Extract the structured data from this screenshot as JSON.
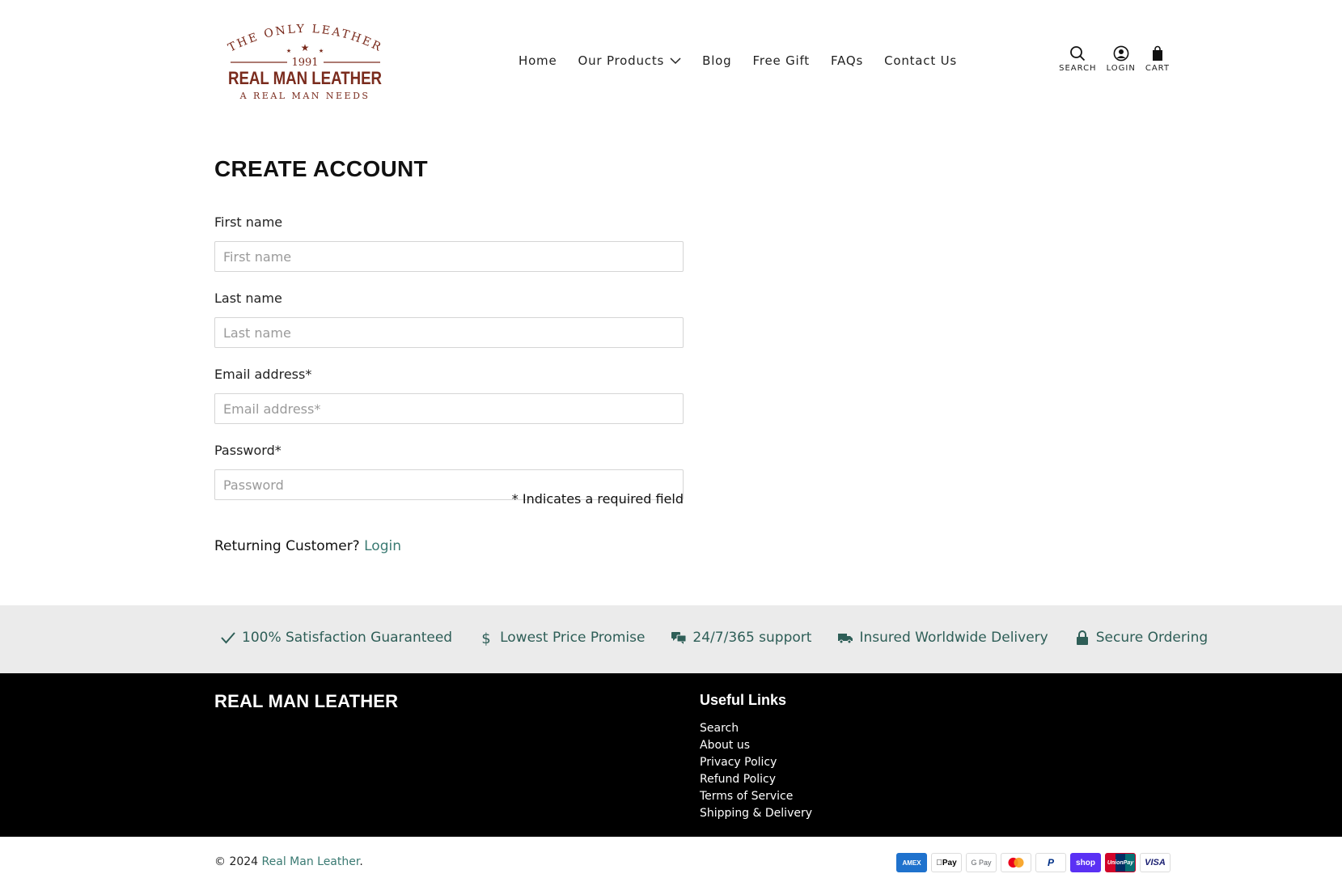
{
  "brand": {
    "logo_top": "THE ONLY LEATHER",
    "logo_year": "1991",
    "logo_main": "REAL MAN LEATHER",
    "logo_tagline": "A REAL MAN NEEDS",
    "logo_color": "#7a2b1d"
  },
  "nav": {
    "items": [
      {
        "label": "Home"
      },
      {
        "label": "Our Products",
        "has_dropdown": true
      },
      {
        "label": "Blog"
      },
      {
        "label": "Free Gift"
      },
      {
        "label": "FAQs"
      },
      {
        "label": "Contact Us"
      }
    ]
  },
  "header_icons": {
    "search_label": "SEARCH",
    "login_label": "LOGIN",
    "cart_label": "CART"
  },
  "page": {
    "title": "CREATE ACCOUNT"
  },
  "form": {
    "first_name": {
      "label": "First name",
      "placeholder": "First name",
      "value": ""
    },
    "last_name": {
      "label": "Last name",
      "placeholder": "Last name",
      "value": ""
    },
    "email": {
      "label": "Email address*",
      "placeholder": "Email address*",
      "value": ""
    },
    "password": {
      "label": "Password*",
      "placeholder": "Password",
      "value": ""
    },
    "required_note": "* Indicates a required field"
  },
  "returning": {
    "text": "Returning Customer?",
    "link": "Login"
  },
  "trust": {
    "items": [
      {
        "icon": "check-icon",
        "label": "100% Satisfaction Guaranteed"
      },
      {
        "icon": "dollar-icon",
        "label": "Lowest Price Promise"
      },
      {
        "icon": "chat-icon",
        "label": "24/7/365 support"
      },
      {
        "icon": "truck-icon",
        "label": "Insured Worldwide Delivery"
      },
      {
        "icon": "lock-icon",
        "label": "Secure Ordering"
      }
    ],
    "color": "#2e5e57"
  },
  "footer": {
    "brand": "REAL MAN LEATHER",
    "links_title": "Useful Links",
    "links": [
      "Search",
      "About us",
      "Privacy Policy",
      "Refund Policy",
      "Terms of Service",
      "Shipping & Delivery"
    ]
  },
  "bottom": {
    "copyright_prefix": "© 2024 ",
    "copyright_link": "Real Man Leather",
    "copyright_suffix": ".",
    "payments": [
      {
        "name": "American Express",
        "short": "AMEX",
        "color": "#1f72cd"
      },
      {
        "name": "Apple Pay",
        "short": "Pay",
        "color": "#ffffff"
      },
      {
        "name": "Google Pay",
        "short": "G Pay",
        "color": "#ffffff"
      },
      {
        "name": "Mastercard",
        "short": "",
        "color": "#ffffff"
      },
      {
        "name": "PayPal",
        "short": "P",
        "color": "#ffffff"
      },
      {
        "name": "Shop Pay",
        "short": "shop",
        "color": "#5a31f4"
      },
      {
        "name": "UnionPay",
        "short": "UnionPay",
        "color": "#d10429"
      },
      {
        "name": "Visa",
        "short": "VISA",
        "color": "#ffffff"
      }
    ]
  },
  "colors": {
    "accent": "#3a7a72",
    "footer_bg": "#000000",
    "trust_bg": "#ebebeb"
  }
}
